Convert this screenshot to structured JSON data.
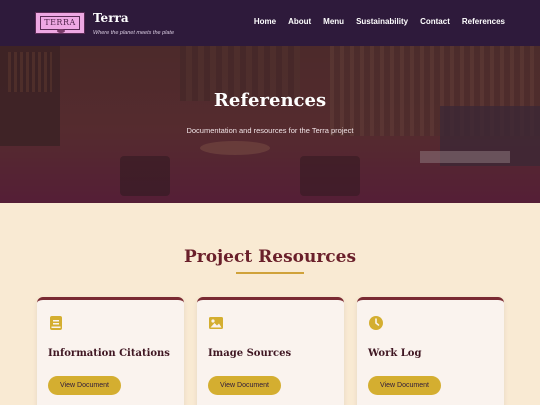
{
  "header": {
    "logo_text": "TERRA",
    "brand_title": "Terra",
    "tagline": "Where the planet meets the plate",
    "nav": [
      "Home",
      "About",
      "Menu",
      "Sustainability",
      "Contact",
      "References"
    ]
  },
  "hero": {
    "title": "References",
    "subtitle": "Documentation and resources for the Terra project"
  },
  "section": {
    "title": "Project Resources"
  },
  "cards": [
    {
      "icon": "book-icon",
      "title": "Information Citations",
      "button": "View Document"
    },
    {
      "icon": "image-icon",
      "title": "Image Sources",
      "button": "View Document"
    },
    {
      "icon": "clock-icon",
      "title": "Work Log",
      "button": "View Document"
    }
  ],
  "colors": {
    "header_bg": "#2e1a3b",
    "accent_gold": "#d4ae30",
    "title_maroon": "#6a1f2a",
    "page_bg": "#f9ead3"
  }
}
